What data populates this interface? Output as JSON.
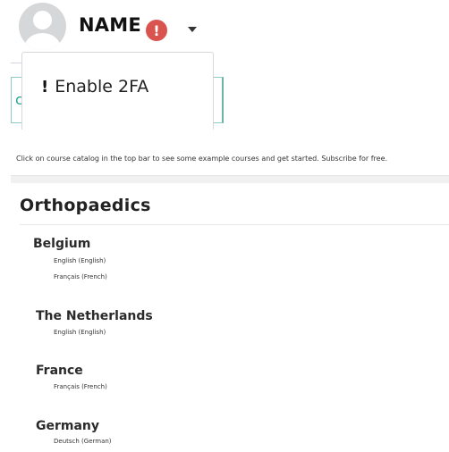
{
  "user": {
    "name": "NAME",
    "alert_glyph": "!",
    "avatar_icon": "user-avatar-icon"
  },
  "dropdown": {
    "items": [
      {
        "icon": "!",
        "label": "Enable 2FA"
      }
    ]
  },
  "background": {
    "fragment": "c"
  },
  "info_text": "Click on course catalog in the top bar to see some example courses and get started. Subscribe for free.",
  "catalog": {
    "title": "Orthopaedics",
    "countries": [
      {
        "name": "Belgium",
        "languages": [
          "English (English)",
          "Français (French)"
        ]
      },
      {
        "name": "The Netherlands",
        "languages": [
          "English (English)"
        ]
      },
      {
        "name": "France",
        "languages": [
          "Français (French)"
        ]
      },
      {
        "name": "Germany",
        "languages": [
          "Deutsch (German)"
        ]
      }
    ]
  },
  "colors": {
    "alert": "#d9534f",
    "teal": "#2aa198",
    "avatar_bg": "#d6d7d9"
  }
}
